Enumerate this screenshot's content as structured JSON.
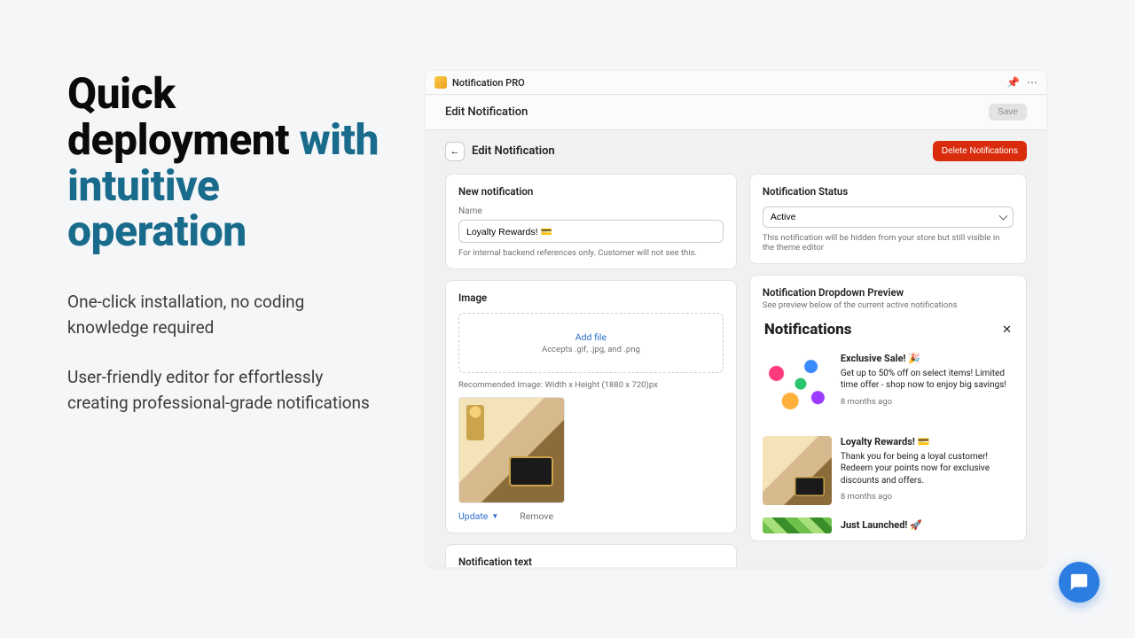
{
  "marketing": {
    "headline_a": "Quick deployment",
    "headline_b": "with intuitive operation",
    "sub1": "One-click installation, no coding knowledge required",
    "sub2": "User-friendly editor for effortlessly creating professional-grade notifications"
  },
  "app": {
    "name": "Notification PRO",
    "subbar_title": "Edit Notification",
    "save_label": "Save",
    "back_icon": "←",
    "page_title": "Edit Notification",
    "delete_label": "Delete Notifications"
  },
  "new_notif": {
    "card_title": "New notification",
    "name_label": "Name",
    "name_value": "Loyalty Rewards! 💳",
    "name_hint": "For internal backend references only. Customer will not see this."
  },
  "image": {
    "card_title": "Image",
    "add_file": "Add file",
    "accepts": "Accepts .gif, .jpg, and .png",
    "reco": "Recommended Image: Width x Height (1880 x 720)px",
    "update": "Update",
    "remove": "Remove"
  },
  "notif_text": {
    "card_title": "Notification text"
  },
  "status": {
    "card_title": "Notification Status",
    "value": "Active",
    "hint": "This notification will be hidden from your store but still visible in the theme editor"
  },
  "preview": {
    "title": "Notification Dropdown Preview",
    "subtitle": "See preview below of the current active notifications",
    "heading": "Notifications",
    "items": [
      {
        "title": "Exclusive Sale! 🎉",
        "desc": "Get up to 50% off on select items! Limited time offer - shop now to enjoy big savings!",
        "date": "8 months ago",
        "thumb": "sale"
      },
      {
        "title": "Loyalty Rewards! 💳",
        "desc": "Thank you for being a loyal customer! Redeem your points now for exclusive discounts and offers.",
        "date": "8 months ago",
        "thumb": "loyalty"
      },
      {
        "title": "Just Launched! 🚀",
        "thumb": "launch"
      }
    ]
  }
}
